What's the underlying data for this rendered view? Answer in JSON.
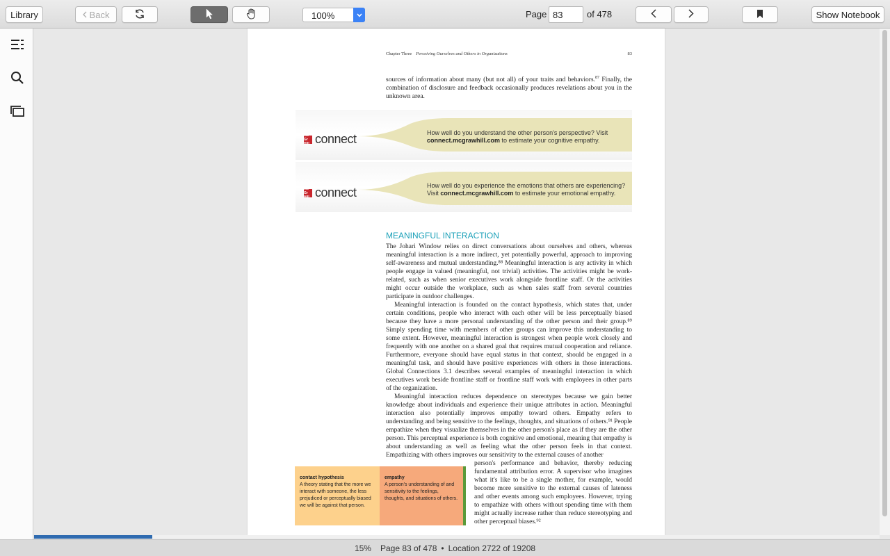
{
  "toolbar": {
    "library": "Library",
    "back": "Back",
    "zoom": "100%",
    "page_label": "Page",
    "page_current": "83",
    "page_total": "of 478",
    "show_notebook": "Show Notebook"
  },
  "page": {
    "running_chapter": "Chapter Three",
    "running_title": "Perceiving Ourselves and Others in Organizations",
    "number": "83",
    "intro_text": "sources of information about many (but not all) of your traits and behaviors.",
    "intro_sup": "87",
    "intro_text_2": " Finally, the combination of disclosure and feedback occasionally produces revelations about you in the unknown area.",
    "banner1_line1": "How well do you understand the other person's perspective? Visit",
    "banner1_url": "connect.mcgrawhill.com",
    "banner1_line2": " to estimate your cognitive empathy.",
    "banner2_line1": "How well do you experience the emotions that others are experiencing?",
    "banner2_pre": "Visit ",
    "banner2_url": "connect.mcgrawhill.com",
    "banner2_line2": " to estimate your emotional empathy.",
    "brand_word": "connect",
    "brand_logo": "Mc Gr Hill",
    "heading": "MEANINGFUL INTERACTION",
    "p1": "The Johari Window relies on direct conversations about ourselves and others, whereas meaningful interaction is a more indirect, yet potentially powerful, approach to improving self-awareness and mutual understanding.⁸⁸ Meaningful interaction is any activity in which people engage in valued (meaningful, not trivial) activities. The activities might be work-related, such as when senior executives work alongside frontline staff. Or the activities might occur outside the workplace, such as when sales staff from several countries participate in outdoor challenges.",
    "p2": "Meaningful interaction is founded on the contact hypothesis, which states that, under certain conditions, people who interact with each other will be less perceptually biased because they have a more personal understanding of the other person and their group.⁸⁹ Simply spending time with members of other groups can improve this understanding to some extent. However, meaningful interaction is strongest when people work closely and frequently with one another on a shared goal that requires mutual cooperation and reliance. Furthermore, everyone should have equal status in that context, should be engaged in a meaningful task, and should have positive experiences with others in those interactions. Global Connections 3.1 describes several examples of meaningful interaction in which executives work beside frontline staff or frontline staff work with employees in other parts of the organization.",
    "p3": "Meaningful interaction reduces dependence on stereotypes because we gain better knowledge about individuals and experience their unique attributes in action. Meaningful interaction also potentially improves empathy toward others. Empathy refers to understanding and being sensitive to the feelings, thoughts, and situations of others.⁹¹ People empathize when they visualize themselves in the other person's place as if they are the other person. This perceptual experience is both cognitive and emotional, meaning that empathy is about understanding as well as feeling what the other person feels in that context. Empathizing with others improves our sensitivity to the external causes of another",
    "p4": "person's performance and behavior, thereby reducing fundamental attribution error. A supervisor who imagines what it's like to be a single mother, for example, would become more sensitive to the external causes of lateness and other events among such employees. However, trying to empathize with others without spending time with them might actually increase rather than reduce stereotyping and other perceptual biases.⁹²",
    "gloss1_term": "contact hypothesis",
    "gloss1_def": "A theory stating that the more we interact with someone, the less prejudiced or perceptually biased we will be against that person.",
    "gloss2_term": "empathy",
    "gloss2_def": "A person's understanding of and sensitivity to the feelings, thoughts, and situations of others."
  },
  "status": {
    "percent": "15%",
    "page": "Page 83 of 478",
    "separator": "•",
    "location": "Location 2722 of 19208",
    "progress": 0.14
  },
  "colors": {
    "accent": "#2f6bb0",
    "heading": "#1aa0b8",
    "gloss1": "#fdd18c",
    "gloss2": "#f6a97b"
  }
}
